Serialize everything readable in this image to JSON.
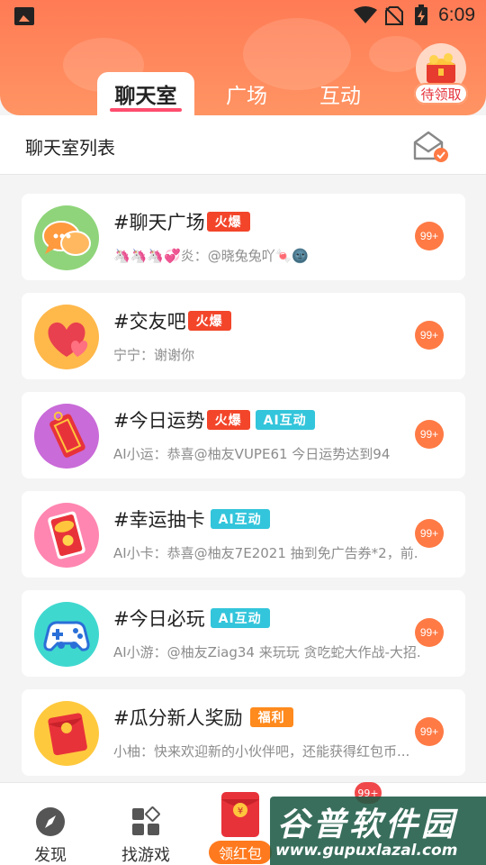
{
  "status_bar": {
    "time": "6:09"
  },
  "tabs": [
    {
      "label": "聊天室",
      "active": true
    },
    {
      "label": "广场",
      "active": false
    },
    {
      "label": "互动",
      "active": false
    }
  ],
  "reward": {
    "label": "待领取"
  },
  "subheader": {
    "title": "聊天室列表",
    "icon": "mail-check-icon"
  },
  "rooms": [
    {
      "name": "#聊天广场",
      "tags": [
        {
          "text": "火爆",
          "type": "hot"
        }
      ],
      "preview": "🦄🦄🦄💞炎：@晓兔兔吖🍬🌚",
      "count": "99+",
      "avatar_icon": "chat-bubbles-icon"
    },
    {
      "name": "#交友吧",
      "tags": [
        {
          "text": "火爆",
          "type": "hot"
        }
      ],
      "preview": "宁宁：谢谢你",
      "count": "99+",
      "avatar_icon": "hearts-icon"
    },
    {
      "name": "#今日运势",
      "tags": [
        {
          "text": "火爆",
          "type": "hot"
        },
        {
          "text": "AI互动",
          "type": "ai"
        }
      ],
      "preview": "AI小运：恭喜@柚友VUPE61 今日运势达到94",
      "count": "99+",
      "avatar_icon": "fortune-tag-icon"
    },
    {
      "name": "#幸运抽卡",
      "tags": [
        {
          "text": "AI互动",
          "type": "ai"
        }
      ],
      "preview": "AI小卡：恭喜@柚友7E2021 抽到免广告券*2，前...",
      "count": "99+",
      "avatar_icon": "lucky-card-icon"
    },
    {
      "name": "#今日必玩",
      "tags": [
        {
          "text": "AI互动",
          "type": "ai"
        }
      ],
      "preview": "AI小游：@柚友Ziag34 来玩玩 贪吃蛇大作战-大招...",
      "count": "99+",
      "avatar_icon": "gamepad-icon"
    },
    {
      "name": "#瓜分新人奖励",
      "tags": [
        {
          "text": "福利",
          "type": "gift"
        }
      ],
      "preview": "小柚：快来欢迎新的小伙伴吧，还能获得红包币...",
      "count": "99+",
      "avatar_icon": "red-envelope-icon"
    }
  ],
  "bottom_nav": {
    "items": [
      {
        "label": "发现",
        "icon": "compass-icon"
      },
      {
        "label": "找游戏",
        "icon": "apps-grid-icon"
      },
      {
        "label": "领红包",
        "icon": "red-envelope-icon"
      }
    ],
    "badge": "99+"
  },
  "watermark": {
    "title": "谷普软件园",
    "url": "www.gupuxlazal.com"
  },
  "colors": {
    "header": "#ff7b55",
    "hot_tag": "#f3452a",
    "ai_tag": "#33c5db",
    "gift_tag": "#ff8a1d",
    "count_badge": "#ff7a45"
  }
}
